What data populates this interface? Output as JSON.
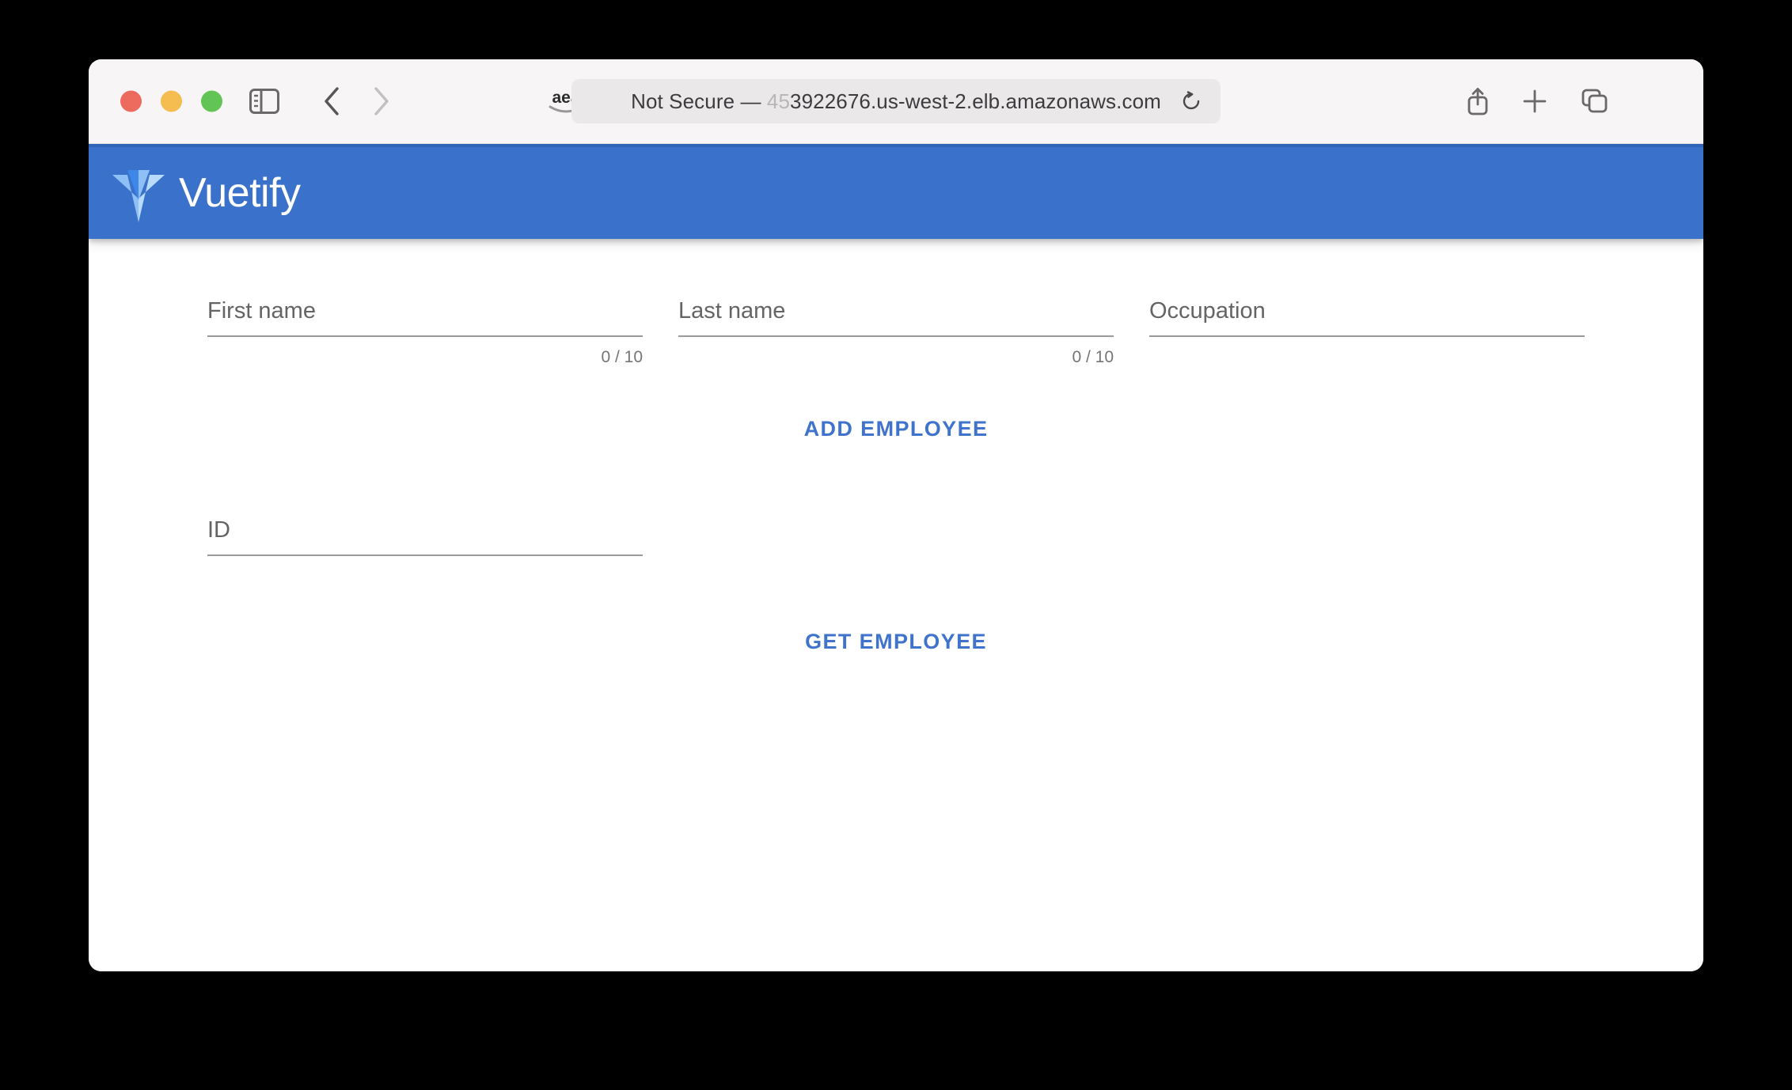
{
  "browser": {
    "traffic_lights": {
      "close_color": "#ed6a5e",
      "minimize_color": "#f5bd4f",
      "maximize_color": "#61c454"
    },
    "address_bar": {
      "security_label": "Not Secure — ",
      "url_dim_part": "45",
      "url_main_part": "3922676.us-west-2.elb.amazonaws.com",
      "full_text": "Not Secure — 453922676.us-west-2.elb.amazonaws.com",
      "favicon_label": "aea",
      "reload_title": "Reload"
    },
    "toolbar_icons": [
      "sidebar-toggle-icon",
      "back-arrow-icon",
      "forward-arrow-icon",
      "amazon-favicon-icon",
      "shield-icon",
      "share-icon",
      "new-tab-icon",
      "tab-overview-icon"
    ]
  },
  "app_bar": {
    "title": "Vuetify",
    "background_color": "#3a71ca",
    "logo_name": "vuetify-logo"
  },
  "form": {
    "fields": [
      {
        "label": "First name",
        "value": "",
        "counter": "0 / 10",
        "has_counter": true
      },
      {
        "label": "Last name",
        "value": "",
        "counter": "0 / 10",
        "has_counter": true
      },
      {
        "label": "Occupation",
        "value": "",
        "counter": "",
        "has_counter": false
      }
    ],
    "id_field": {
      "label": "ID",
      "value": "",
      "counter": "",
      "has_counter": false
    },
    "add_button_label": "ADD EMPLOYEE",
    "get_button_label": "GET EMPLOYEE",
    "button_color": "#3f73cc"
  }
}
